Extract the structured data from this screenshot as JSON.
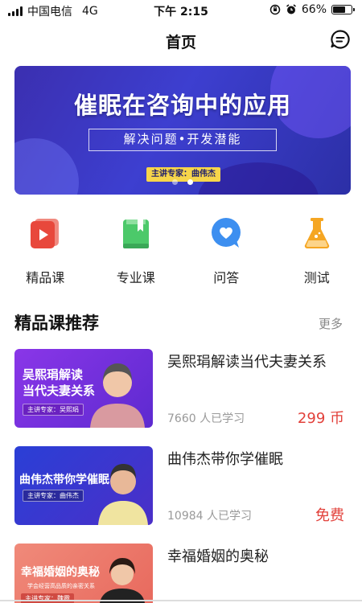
{
  "status_bar": {
    "carrier": "中国电信",
    "network": "4G",
    "time": "下午 2:15",
    "battery": "66%",
    "battery_level": 0.66
  },
  "nav": {
    "title": "首页",
    "right_icon": "message-icon"
  },
  "banner": {
    "title": "催眠在咨询中的应用",
    "subtitle": "解决问题•开发潜能",
    "tag": "主讲专家：曲伟杰",
    "dots": 2,
    "active_dot": 1
  },
  "categories": [
    {
      "label": "精品课",
      "icon": "video-play-icon",
      "color": "#e8483c"
    },
    {
      "label": "专业课",
      "icon": "book-icon",
      "color": "#4cc96a"
    },
    {
      "label": "问答",
      "icon": "heart-chat-icon",
      "color": "#3d8ff0"
    },
    {
      "label": "测试",
      "icon": "flask-icon",
      "color": "#f5a623"
    }
  ],
  "section": {
    "title": "精品课推荐",
    "more": "更多"
  },
  "courses": [
    {
      "thumb_title": "吴熙琄解读\n当代夫妻关系",
      "thumb_tag": "主讲专家：吴熙琄",
      "title": "吴熙琄解读当代夫妻关系",
      "learners": "7660 人已学习",
      "price": "299 币"
    },
    {
      "thumb_title": "曲伟杰带你学催眠",
      "thumb_tag": "主讲专家：曲伟杰",
      "title": "曲伟杰带你学催眠",
      "learners": "10984 人已学习",
      "price": "免费"
    },
    {
      "thumb_title": "幸福婚姻的奥秘",
      "thumb_subtitle": "学会经营高品质的亲密关系",
      "thumb_tag": "主讲专家：魏霞",
      "title": "幸福婚姻的奥秘",
      "learners": "",
      "price": ""
    }
  ],
  "colors": {
    "accent_price": "#e2403a",
    "banner_bg": "#3b2fb0"
  }
}
